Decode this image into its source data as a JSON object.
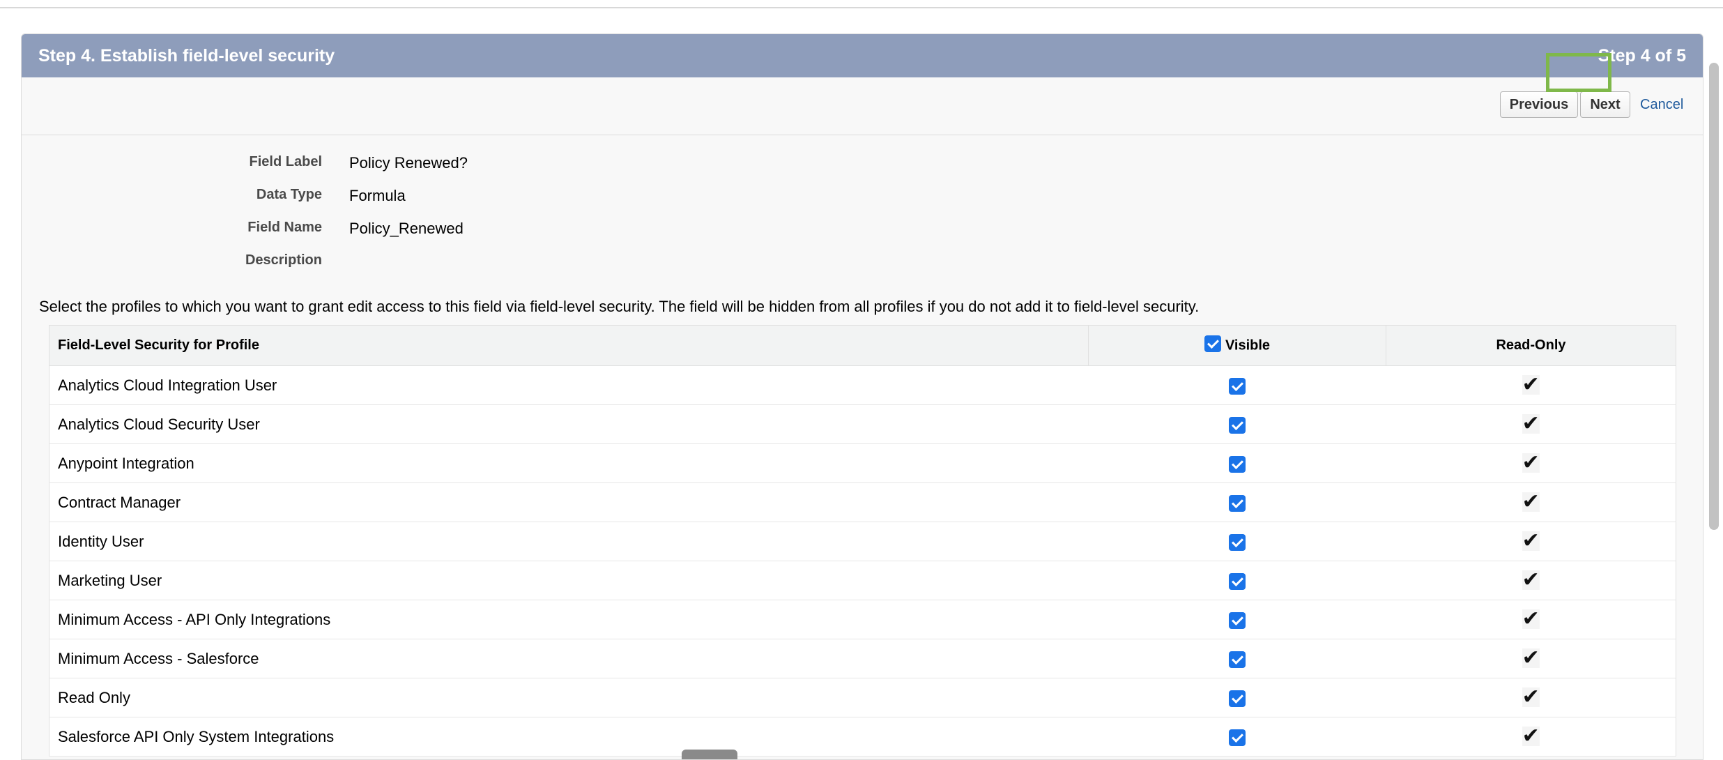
{
  "header": {
    "title": "Step 4. Establish field-level security",
    "step": "Step 4 of 5"
  },
  "buttons": {
    "previous": "Previous",
    "next": "Next",
    "cancel": "Cancel"
  },
  "details": [
    {
      "label": "Field Label",
      "value": "Policy Renewed?"
    },
    {
      "label": "Data Type",
      "value": "Formula"
    },
    {
      "label": "Field Name",
      "value": "Policy_Renewed"
    },
    {
      "label": "Description",
      "value": ""
    }
  ],
  "instructions": "Select the profiles to which you want to grant edit access to this field via field-level security. The field will be hidden from all profiles if you do not add it to field-level security.",
  "table": {
    "headers": {
      "profile": "Field-Level Security for Profile",
      "visible": "Visible",
      "readonly": "Read-Only"
    },
    "header_visible_checked": true,
    "rows": [
      {
        "profile": "Analytics Cloud Integration User",
        "visible": true,
        "readonly": true
      },
      {
        "profile": "Analytics Cloud Security User",
        "visible": true,
        "readonly": true
      },
      {
        "profile": "Anypoint Integration",
        "visible": true,
        "readonly": true
      },
      {
        "profile": "Contract Manager",
        "visible": true,
        "readonly": true
      },
      {
        "profile": "Identity User",
        "visible": true,
        "readonly": true
      },
      {
        "profile": "Marketing User",
        "visible": true,
        "readonly": true
      },
      {
        "profile": "Minimum Access - API Only Integrations",
        "visible": true,
        "readonly": true
      },
      {
        "profile": "Minimum Access - Salesforce",
        "visible": true,
        "readonly": true
      },
      {
        "profile": "Read Only",
        "visible": true,
        "readonly": true
      },
      {
        "profile": "Salesforce API Only System Integrations",
        "visible": true,
        "readonly": true
      }
    ]
  },
  "colors": {
    "header_bg": "#8e9dbb",
    "checkbox": "#1a73e8",
    "highlight": "#7fb84a",
    "link": "#1f5a9c"
  }
}
